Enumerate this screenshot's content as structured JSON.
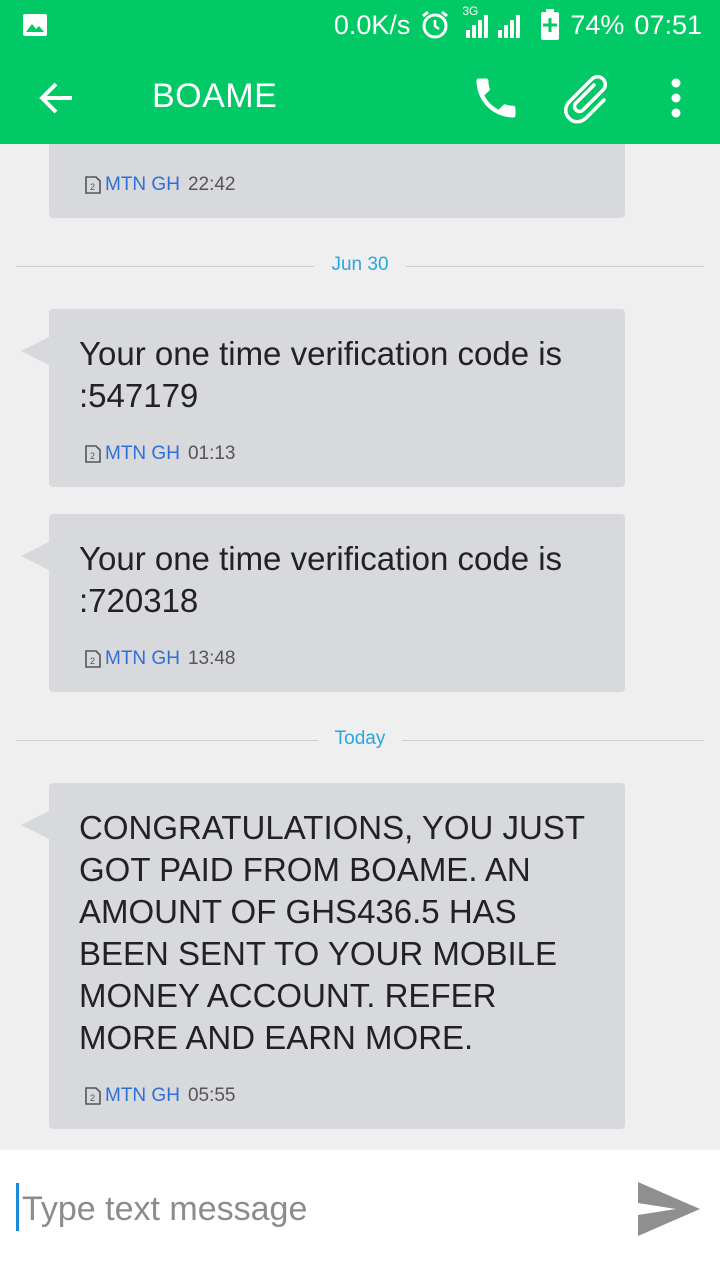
{
  "status_bar": {
    "network_speed": "0.0K/s",
    "network_type": "3G",
    "battery": "74%",
    "time": "07:51",
    "icons": [
      "gallery-icon",
      "alarm-icon",
      "signal-icon",
      "battery-icon"
    ]
  },
  "toolbar": {
    "title": "BOAME",
    "icons": [
      "back-arrow-icon",
      "phone-icon",
      "attachment-icon",
      "more-vert-icon"
    ]
  },
  "colors": {
    "accent": "#00c966",
    "bubble": "#d7d9dc",
    "sender": "#2f6fd6",
    "date_label": "#2aa6e0"
  },
  "conversation": {
    "messages": [
      {
        "body": "",
        "sender": "MTN GH",
        "time": "22:42"
      },
      {
        "body": "Your one time verification code is :547179",
        "sender": "MTN GH",
        "time": "01:13"
      },
      {
        "body": "Your one time verification code is :720318",
        "sender": "MTN GH",
        "time": "13:48"
      },
      {
        "body": "CONGRATULATIONS, YOU JUST GOT PAID FROM BOAME. AN AMOUNT OF GHS436.5 HAS BEEN SENT TO YOUR MOBILE MONEY ACCOUNT. REFER MORE AND EARN MORE.",
        "sender": "MTN GH",
        "time": "05:55"
      }
    ],
    "date_dividers": [
      "Jun 30",
      "Today"
    ]
  },
  "compose": {
    "placeholder": "Type text message",
    "send_icon": "send-icon"
  }
}
